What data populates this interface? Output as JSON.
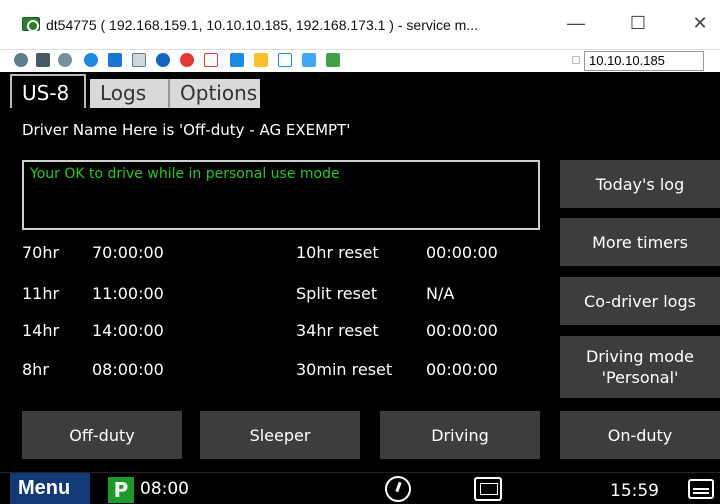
{
  "window": {
    "title": "dt54775 ( 192.168.159.1, 10.10.10.185, 192.168.173.1 ) - service m...",
    "minimize": "—",
    "maximize": "☐",
    "close": "✕"
  },
  "toolbar": {
    "ip_value": "10.10.10.185",
    "icons": [
      "gear-icon",
      "screen-icon",
      "settings-icon",
      "refresh-icon",
      "windows-icon",
      "doc-icon",
      "info-icon",
      "stop-icon",
      "close-doc-icon",
      "monitor-icon",
      "folder-icon",
      "network-icon",
      "device-icon",
      "chat-icon"
    ]
  },
  "tabs": {
    "us8": "US-8",
    "logs": "Logs",
    "options": "Options"
  },
  "driver_line": "Driver Name Here is 'Off-duty - AG EXEMPT'",
  "message": "Your OK to drive while in personal use mode",
  "timers": [
    {
      "label": "70hr",
      "value": "70:00:00",
      "label2": "10hr reset",
      "value2": "00:00:00"
    },
    {
      "label": "11hr",
      "value": "11:00:00",
      "label2": "Split reset",
      "value2": "N/A"
    },
    {
      "label": "14hr",
      "value": "14:00:00",
      "label2": "34hr reset",
      "value2": "00:00:00"
    },
    {
      "label": "8hr",
      "value": "08:00:00",
      "label2": "30min reset",
      "value2": "00:00:00"
    }
  ],
  "side_buttons": {
    "todays_log": "Today's log",
    "more_timers": "More timers",
    "codriver_logs": "Co-driver logs",
    "driving_mode_1": "Driving mode",
    "driving_mode_2": "'Personal'"
  },
  "bottom_buttons": {
    "off_duty": "Off-duty",
    "sleeper": "Sleeper",
    "driving": "Driving",
    "on_duty": "On-duty"
  },
  "statusbar": {
    "menu": "Menu",
    "p_badge": "P",
    "p_time": "08:00",
    "clock": "15:59"
  },
  "colors": {
    "message_green": "#25c825",
    "button_gray": "#3d3d3d",
    "menu_blue": "#123a78",
    "p_green": "#1e9a2b"
  }
}
